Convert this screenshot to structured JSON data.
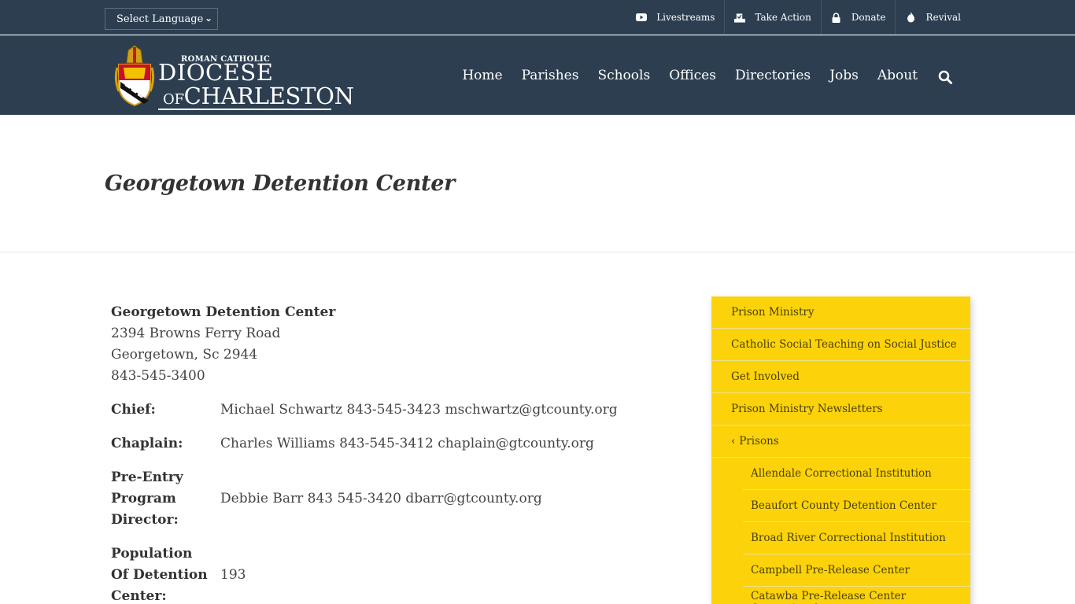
{
  "topbar": {
    "language_select": "Select Language",
    "links": [
      {
        "label": "Livestreams",
        "icon": "youtube-icon"
      },
      {
        "label": "Take Action",
        "icon": "ballot-icon"
      },
      {
        "label": "Donate",
        "icon": "lock-icon"
      },
      {
        "label": "Revival",
        "icon": "flame-icon"
      }
    ]
  },
  "header": {
    "logo": {
      "line_small": "ROMAN CATHOLIC",
      "line1": "DIOCESE",
      "line2_of": "OF",
      "line2_main": "CHARLESTON"
    },
    "nav": [
      "Home",
      "Parishes",
      "Schools",
      "Offices",
      "Directories",
      "Jobs",
      "About"
    ]
  },
  "page": {
    "title": "Georgetown Detention Center"
  },
  "content": {
    "address": {
      "name": "Georgetown Detention Center",
      "street": "2394 Browns Ferry Road",
      "city": "Georgetown, Sc 2944",
      "phone": "843-545-3400"
    },
    "rows": [
      {
        "label": "Chief:",
        "value": "Michael Schwartz 843-545-3423 mschwartz@gtcounty.org"
      },
      {
        "label": "Chaplain:",
        "value": "Charles Williams 843-545-3412 chaplain@gtcounty.org"
      },
      {
        "label": "Pre-Entry Program Director:",
        "value": "Debbie Barr 843 545-3420 dbarr@gtcounty.org"
      },
      {
        "label": "Population Of Detention Center:",
        "value": "193"
      }
    ]
  },
  "sidebar": {
    "items": [
      {
        "label": "Prison Ministry"
      },
      {
        "label": "Catholic Social Teaching on Social Justice"
      },
      {
        "label": "Get Involved"
      },
      {
        "label": "Prison Ministry Newsletters"
      },
      {
        "label": "Prisons"
      }
    ],
    "sub_items": [
      "Allendale Correctional Institution",
      "Beaufort County Detention Center",
      "Broad River Correctional Institution",
      "Campbell Pre-Release Center",
      "Catawba Pre-Release Center Correctional"
    ]
  },
  "colors": {
    "header_bg": "#2c3e50",
    "sidebar_bg": "#fcd30b"
  }
}
